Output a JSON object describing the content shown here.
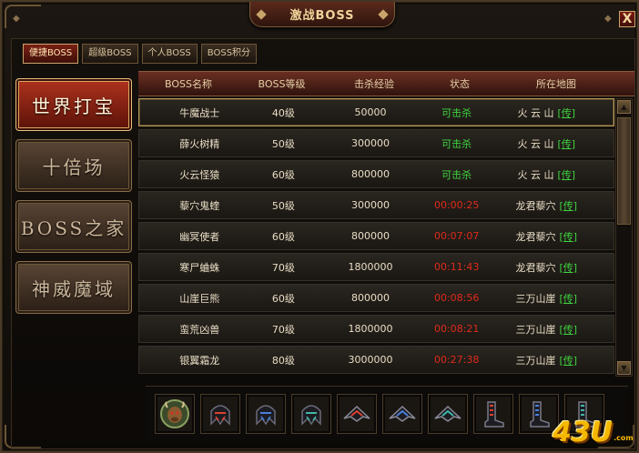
{
  "title": "激战BOSS",
  "close_label": "X",
  "tabs": [
    {
      "label": "便捷BOSS",
      "active": true
    },
    {
      "label": "超级BOSS",
      "active": false
    },
    {
      "label": "个人BOSS",
      "active": false
    },
    {
      "label": "BOSS积分",
      "active": false
    }
  ],
  "side_menu": [
    {
      "label": "世界打宝",
      "active": true
    },
    {
      "label": "十倍场",
      "active": false
    },
    {
      "label": "BOSS之家",
      "active": false
    },
    {
      "label": "神威魔域",
      "active": false
    }
  ],
  "table": {
    "headers": [
      "BOSS名称",
      "BOSS等级",
      "击杀经验",
      "状态",
      "所在地图"
    ],
    "rows": [
      {
        "name": "牛魔战士",
        "level": "40级",
        "exp": "50000",
        "status": "可击杀",
        "status_color": "#3fd43f",
        "map": "火 云 山",
        "link": "[传]"
      },
      {
        "name": "薛火树精",
        "level": "50级",
        "exp": "300000",
        "status": "可击杀",
        "status_color": "#3fd43f",
        "map": "火 云 山",
        "link": "[传]"
      },
      {
        "name": "火云怪猿",
        "level": "60级",
        "exp": "800000",
        "status": "可击杀",
        "status_color": "#3fd43f",
        "map": "火 云 山",
        "link": "[传]"
      },
      {
        "name": "藜穴鬼蝰",
        "level": "50级",
        "exp": "300000",
        "status": "00:00:25",
        "status_color": "#e02a1a",
        "map": "龙君藜穴",
        "link": "[传]"
      },
      {
        "name": "幽冥使者",
        "level": "60级",
        "exp": "800000",
        "status": "00:07:07",
        "status_color": "#e02a1a",
        "map": "龙君藜穴",
        "link": "[传]"
      },
      {
        "name": "寒尸蛐蛛",
        "level": "70级",
        "exp": "1800000",
        "status": "00:11:43",
        "status_color": "#e02a1a",
        "map": "龙君藜穴",
        "link": "[传]"
      },
      {
        "name": "山崖巨熊",
        "level": "60级",
        "exp": "800000",
        "status": "00:08:56",
        "status_color": "#e02a1a",
        "map": "三万山崖",
        "link": "[传]"
      },
      {
        "name": "蛮荒凶兽",
        "level": "70级",
        "exp": "1800000",
        "status": "00:08:21",
        "status_color": "#e02a1a",
        "map": "三万山崖",
        "link": "[传]"
      },
      {
        "name": "银翼霜龙",
        "level": "80级",
        "exp": "3000000",
        "status": "00:27:38",
        "status_color": "#e02a1a",
        "map": "三万山崖",
        "link": "[传]"
      }
    ]
  },
  "reward_icons": [
    "bull-head-icon",
    "red-helmet-icon",
    "blue-helmet-icon",
    "teal-helmet-icon",
    "red-wing-icon",
    "blue-wing-icon",
    "teal-wing-icon",
    "red-boots-icon",
    "blue-boots-icon",
    "teal-boots-icon"
  ],
  "logo": {
    "main": "43U",
    "suffix": ".com"
  },
  "colors": {
    "accent_red": "#b0321e",
    "gold": "#c9a46a",
    "available": "#3fd43f",
    "timer": "#e02a1a"
  }
}
